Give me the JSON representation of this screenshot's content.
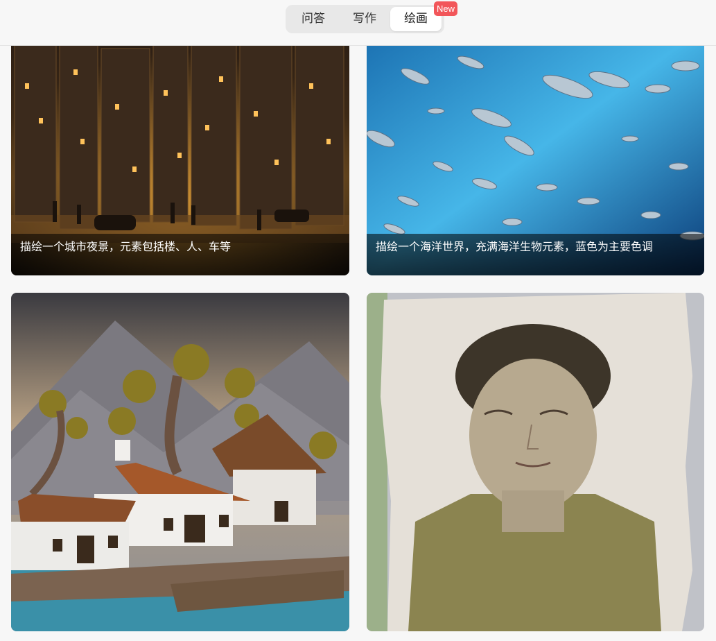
{
  "header": {
    "tabs": [
      {
        "label": "问答",
        "active": false
      },
      {
        "label": "写作",
        "active": false
      },
      {
        "label": "绘画",
        "active": true
      }
    ],
    "new_badge": "New"
  },
  "gallery": {
    "cards": [
      {
        "caption": "描绘一个城市夜景，元素包括楼、人、车等"
      },
      {
        "caption": "描绘一个海洋世界，充满海洋生物元素，蓝色为主要色调"
      },
      {
        "caption": ""
      },
      {
        "caption": ""
      }
    ]
  },
  "colors": {
    "badge": "#f2565a",
    "active_tab": "#ffffff",
    "tab_track": "#e8e8e8",
    "background": "#f7f7f7"
  }
}
